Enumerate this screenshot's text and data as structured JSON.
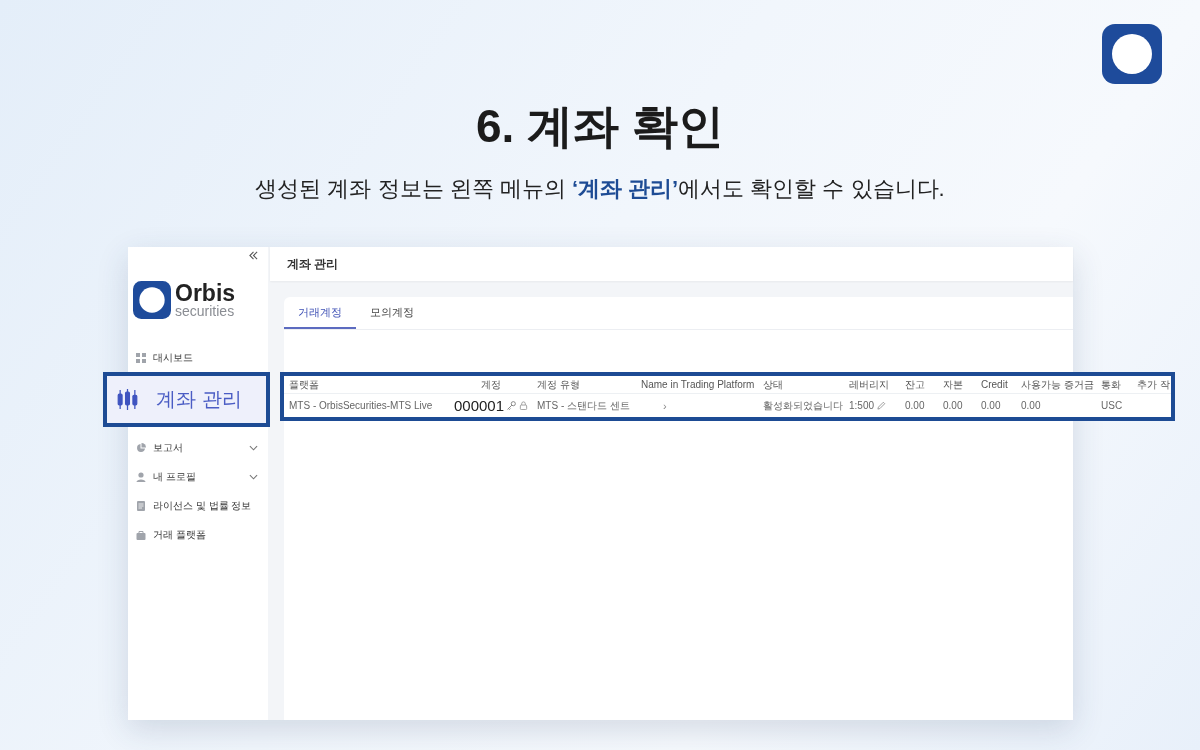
{
  "heading": {
    "title": "6. 계좌 확인",
    "subtitle": "생성된 계좌 정보는 왼쪽 메뉴의 **‘계좌 관리’**에서도 확인할 수 있습니다."
  },
  "brand": {
    "name": "Orbis",
    "tagline": "securities"
  },
  "sidebar": {
    "items": [
      {
        "label": "대시보드",
        "selected": false,
        "has_submenu": false
      },
      {
        "label": "계좌 관리",
        "selected": true,
        "has_submenu": false
      },
      {
        "label": "보고서",
        "selected": false,
        "has_submenu": true
      },
      {
        "label": "내 프로필",
        "selected": false,
        "has_submenu": true
      },
      {
        "label": "라이선스 및 법률 정보",
        "selected": false,
        "has_submenu": false
      },
      {
        "label": "거래 플랫폼",
        "selected": false,
        "has_submenu": false
      }
    ]
  },
  "page_title": "계좌 관리",
  "tabs": [
    {
      "label": "거래계정",
      "selected": true
    },
    {
      "label": "모의계정",
      "selected": false
    }
  ],
  "table": {
    "columns": [
      "플랫폼",
      "계정",
      "계정 유형",
      "Name in Trading Platform",
      "상태",
      "레버리지",
      "잔고",
      "자본",
      "Credit",
      "사용가능 증거금",
      "통화",
      "추가 작"
    ],
    "rows": [
      {
        "cells": [
          "MTS - OrbisSecurities-MTS Live",
          "000001",
          "MTS - 스탠다드 센트",
          "›",
          "활성화되었습니다",
          "1:500",
          "0.00",
          "0.00",
          "0.00",
          "0.00",
          "USC"
        ]
      }
    ]
  }
}
